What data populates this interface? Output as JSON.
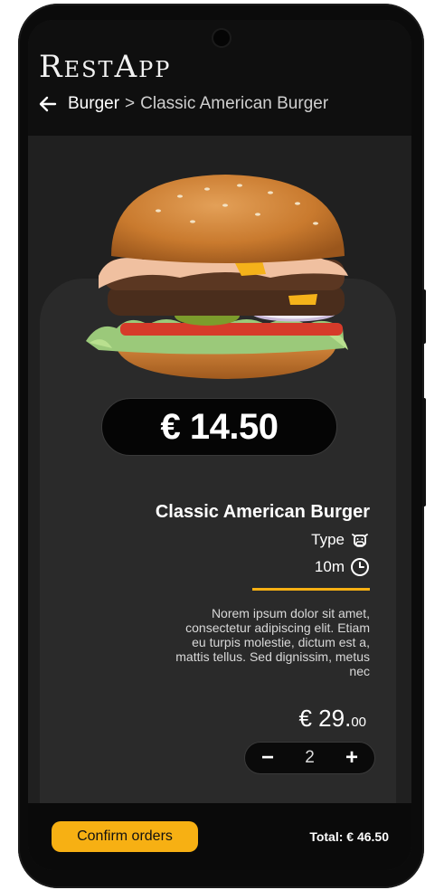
{
  "app": {
    "logo": "RestApp"
  },
  "breadcrumb": {
    "category": "Burger",
    "separator": ">",
    "current": "Classic American Burger"
  },
  "product": {
    "price_badge": "€ 14.50",
    "name": "Classic American Burger",
    "type_label": "Type",
    "time_label": "10m",
    "description": "Norem ipsum dolor sit amet, consectetur adipiscing elit. Etiam eu turpis molestie, dictum est a, mattis tellus. Sed dignissim, metus nec",
    "line_price_main": "€ 29.",
    "line_price_cents": "00",
    "quantity": "2",
    "decrement_label": "−",
    "increment_label": "+"
  },
  "footer": {
    "confirm_label": "Confirm orders",
    "total_label": "Total: € 46.50"
  },
  "colors": {
    "accent": "#f7b013",
    "background": "#202020",
    "card": "#2a2a2a"
  },
  "icons": {
    "back": "arrow-left-icon",
    "type": "cow-icon",
    "time": "clock-icon"
  }
}
